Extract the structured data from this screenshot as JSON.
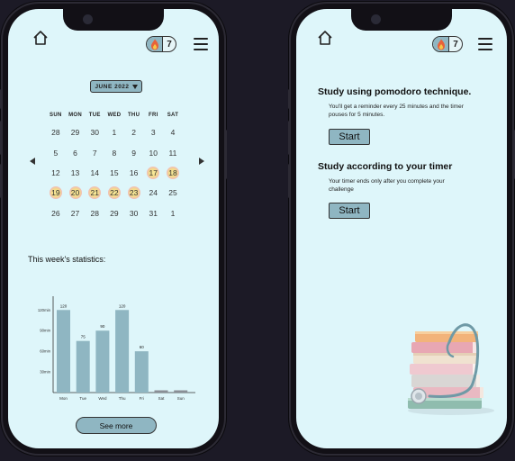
{
  "header": {
    "streak_count": "7",
    "icons": [
      "home-icon",
      "flame-icon",
      "menu-icon"
    ]
  },
  "calendar": {
    "month_label": "JUNE 2022",
    "weekdays": [
      "SUN",
      "MON",
      "TUE",
      "WED",
      "THU",
      "FRI",
      "SAT"
    ],
    "weeks": [
      [
        "28",
        "29",
        "30",
        "1",
        "2",
        "3",
        "4"
      ],
      [
        "5",
        "6",
        "7",
        "8",
        "9",
        "10",
        "11"
      ],
      [
        "12",
        "13",
        "14",
        "15",
        "16",
        "17",
        "18"
      ],
      [
        "19",
        "20",
        "21",
        "22",
        "23",
        "24",
        "25"
      ],
      [
        "26",
        "27",
        "28",
        "29",
        "30",
        "31",
        "1"
      ]
    ],
    "highlighted_days": [
      "17",
      "18",
      "19",
      "20",
      "21",
      "22",
      "23"
    ]
  },
  "stats": {
    "title": "This week's statistics:",
    "see_more_label": "See more"
  },
  "chart_data": {
    "type": "bar",
    "categories": [
      "Mon",
      "Tue",
      "Wed",
      "Thu",
      "Fri",
      "Sat",
      "Sun"
    ],
    "values": [
      120,
      75,
      90,
      120,
      60,
      0,
      0
    ],
    "data_labels": [
      "120",
      "75",
      "90",
      "120",
      "60",
      "",
      ""
    ],
    "y_ticks": [
      "30min",
      "60min",
      "90min",
      "120min"
    ],
    "y_tick_values": [
      30,
      60,
      90,
      120
    ],
    "ylim": [
      0,
      140
    ],
    "bar_color": "#8fb6c2"
  },
  "study": {
    "pomodoro": {
      "title": "Study using pomodoro technique.",
      "desc": "You'll get a reminder every 25 minutes and the timer pouses for 5 minutes.",
      "start_label": "Start"
    },
    "timer": {
      "title": "Study according to your timer",
      "desc": "Your timer ends only after you complete your challenge",
      "start_label": "Start"
    }
  },
  "colors": {
    "screen_bg": "#def6fa",
    "accent": "#8fb6c2",
    "highlight": "#f3d98a"
  }
}
